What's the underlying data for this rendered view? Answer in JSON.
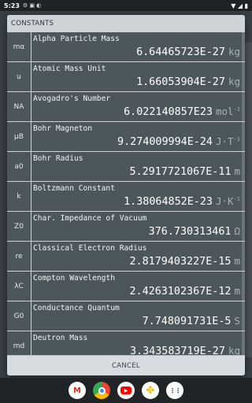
{
  "status_bar": {
    "time": "5:23",
    "notification_icons": "⚙ ▣ ◐",
    "right_icons": "▼ ◢ ▮"
  },
  "dialog": {
    "title": "CONSTANTS",
    "cancel_label": "CANCEL",
    "constants": [
      {
        "symbol": "mα",
        "name": "Alpha Particle Mass",
        "value": "6.64465723E-27",
        "unit": "kg",
        "unit_sup": ""
      },
      {
        "symbol": "u",
        "name": "Atomic Mass Unit",
        "value": "1.66053904E-27",
        "unit": "kg",
        "unit_sup": ""
      },
      {
        "symbol": "NA",
        "name": "Avogadro's Number",
        "value": "6.022140857E23",
        "unit": "mol",
        "unit_sup": "-1"
      },
      {
        "symbol": "μB",
        "name": "Bohr Magneton",
        "value": "9.274009994E-24",
        "unit": "J·T",
        "unit_sup": "-1"
      },
      {
        "symbol": "a0",
        "name": "Bohr Radius",
        "value": "5.2917721067E-11",
        "unit": "m",
        "unit_sup": ""
      },
      {
        "symbol": "k",
        "name": "Boltzmann Constant",
        "value": "1.38064852E-23",
        "unit": "J·K",
        "unit_sup": "-1"
      },
      {
        "symbol": "Z0",
        "name": "Char. Impedance of Vacuum",
        "value": "376.730313461",
        "unit": "Ω",
        "unit_sup": ""
      },
      {
        "symbol": "re",
        "name": "Classical Electron Radius",
        "value": "2.8179403227E-15",
        "unit": "m",
        "unit_sup": ""
      },
      {
        "symbol": "λC",
        "name": "Compton Wavelength",
        "value": "2.4263102367E-12",
        "unit": "m",
        "unit_sup": ""
      },
      {
        "symbol": "G0",
        "name": "Conductance Quantum",
        "value": "7.748091731E-5",
        "unit": "S",
        "unit_sup": ""
      },
      {
        "symbol": "md",
        "name": "Deutron Mass",
        "value": "3.343583719E-27",
        "unit": "kg",
        "unit_sup": ""
      }
    ]
  },
  "dock": {
    "apps": [
      {
        "name": "gmail-icon",
        "glyph": "M"
      },
      {
        "name": "chrome-icon",
        "glyph": ""
      },
      {
        "name": "youtube-icon",
        "glyph": "▶"
      },
      {
        "name": "photos-icon",
        "glyph": "✤"
      },
      {
        "name": "app-drawer-icon",
        "glyph": "⋮⋮"
      }
    ]
  }
}
